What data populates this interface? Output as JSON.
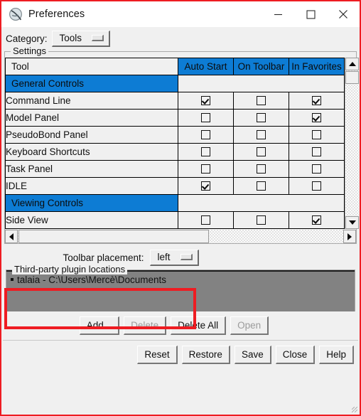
{
  "window": {
    "title": "Preferences",
    "icon": "chimera-logo-icon",
    "minimize": "minimize-icon",
    "maximize": "maximize-icon",
    "close": "close-icon"
  },
  "category": {
    "label": "Category:",
    "selected": "Tools"
  },
  "settings": {
    "group_title": "Settings",
    "columns": [
      "Tool",
      "Auto Start",
      "On Toolbar",
      "In Favorites"
    ],
    "rows": [
      {
        "type": "category",
        "name": "General Controls",
        "auto_start": null,
        "on_toolbar": null,
        "in_favorites": null
      },
      {
        "type": "tool",
        "name": "Command Line",
        "auto_start": true,
        "on_toolbar": false,
        "in_favorites": true
      },
      {
        "type": "tool",
        "name": "Model Panel",
        "auto_start": false,
        "on_toolbar": false,
        "in_favorites": true
      },
      {
        "type": "tool",
        "name": "PseudoBond Panel",
        "auto_start": false,
        "on_toolbar": false,
        "in_favorites": false
      },
      {
        "type": "tool",
        "name": "Keyboard Shortcuts",
        "auto_start": false,
        "on_toolbar": false,
        "in_favorites": false
      },
      {
        "type": "tool",
        "name": "Task Panel",
        "auto_start": false,
        "on_toolbar": false,
        "in_favorites": false
      },
      {
        "type": "tool",
        "name": "IDLE",
        "auto_start": true,
        "on_toolbar": false,
        "in_favorites": false
      },
      {
        "type": "category",
        "name": "Viewing Controls",
        "auto_start": null,
        "on_toolbar": null,
        "in_favorites": null
      },
      {
        "type": "tool",
        "name": "Side View",
        "auto_start": false,
        "on_toolbar": false,
        "in_favorites": true
      }
    ]
  },
  "placement": {
    "label": "Toolbar placement:",
    "selected": "left"
  },
  "plugins": {
    "group_title": "Third-party plugin locations",
    "items": [
      "talaia - C:\\Users\\Mercè\\Documents"
    ],
    "highlight_color": "#ee1c22"
  },
  "plugin_buttons": [
    {
      "label": "Add...",
      "enabled": true
    },
    {
      "label": "Delete",
      "enabled": false
    },
    {
      "label": "Delete All",
      "enabled": true
    },
    {
      "label": "Open",
      "enabled": false
    }
  ],
  "dialog_buttons": [
    {
      "label": "Reset",
      "enabled": true
    },
    {
      "label": "Restore",
      "enabled": true
    },
    {
      "label": "Save",
      "enabled": true
    },
    {
      "label": "Close",
      "enabled": true
    },
    {
      "label": "Help",
      "enabled": true
    }
  ]
}
